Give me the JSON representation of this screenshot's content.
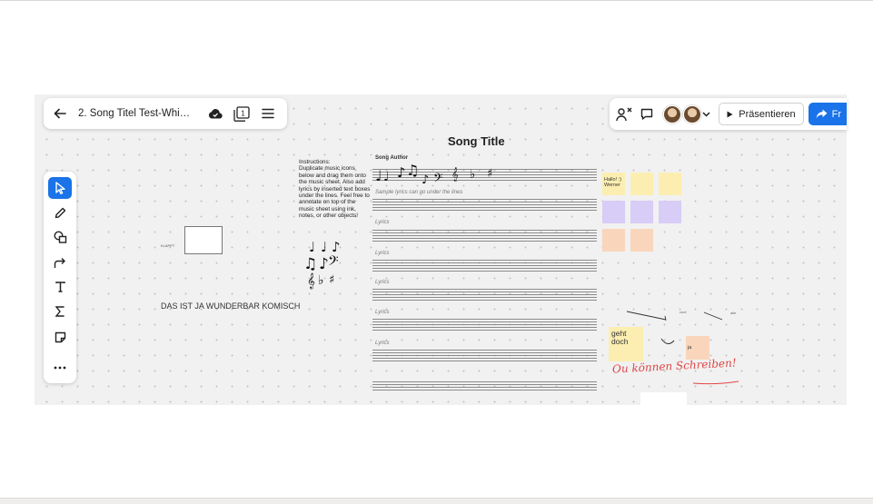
{
  "window": {
    "doc_title": "2. Song Titel Test-Whit...",
    "back_icon": "arrow-left-icon",
    "cloud_icon": "cloud-saved-icon",
    "pages_icon": "pages-icon",
    "pages_count": "1",
    "menu_icon": "hamburger-menu-icon"
  },
  "header_right": {
    "present_label": "Präsentieren",
    "share_label": "Fr"
  },
  "board": {
    "song_title": "Song Title",
    "song_author": "Song Author",
    "instructions_title": "Instructions:",
    "instructions_body": "Duplicate music icons below and drag them onto the music sheet. Also add lyrics by inserted text boxes under the lines. Feel free to annotate on top of the music sheet using ink, notes, or other objects!",
    "sample_lyrics": "Sample lyrics can go under the lines",
    "lyrics_labels": [
      "Lyrics",
      "Lyrics",
      "Lyrics",
      "Lyrics",
      "Lyrics"
    ],
    "small_label": "KLAPPT",
    "komisch_text": "DAS IST JA WUNDERBAR KOMISCH",
    "sticky_hallo": "Hallo! :) Werner",
    "sticky_geht": "geht doch",
    "sticky_ja": "ja",
    "tiny_note_1": "cool",
    "tiny_note_2": "alle",
    "handwriting": "Ou können Schreiben!"
  },
  "colors": {
    "accent": "#1a73e8",
    "sticky_yellow": "#fbeeb0",
    "sticky_purple": "#d7cdf6",
    "sticky_orange": "#f9d6bb",
    "ink_red": "#e04545"
  }
}
